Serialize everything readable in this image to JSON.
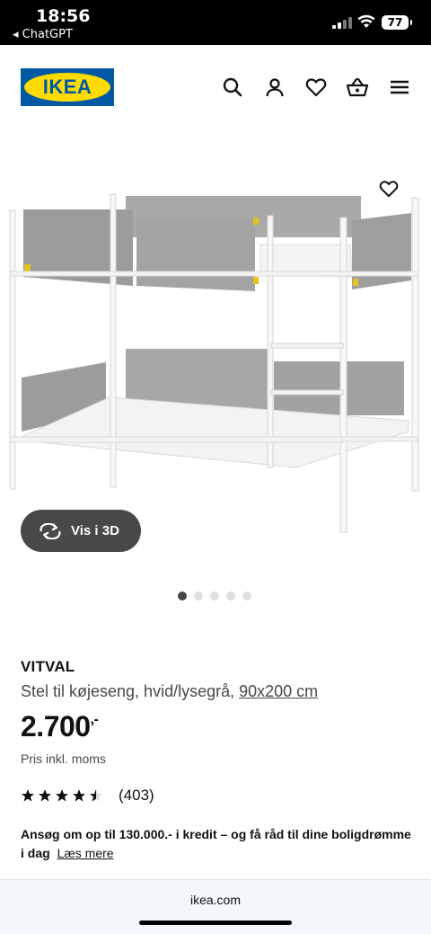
{
  "status_bar": {
    "time": "18:56",
    "back_label": "◂ ChatGPT",
    "battery": "77"
  },
  "header": {
    "logo_text": "IKEA",
    "icons": [
      "search-icon",
      "user-icon",
      "heart-icon",
      "basket-icon",
      "menu-icon"
    ]
  },
  "gallery": {
    "view3d_label": "Vis i 3D",
    "dots_count": 5,
    "active_dot": 0
  },
  "product": {
    "name": "VITVAL",
    "description": "Stel til køjeseng, hvid/lysegrå,",
    "size_link": "90x200 cm",
    "price": "2.700",
    "price_suffix": ",-",
    "price_note": "Pris inkl. moms",
    "rating_stars": 4.5,
    "rating_count": "(403)",
    "credit_text": "Ansøg om op til 130.000.- i kredit – og få råd til dine boligdrømme i dag",
    "credit_link": "Læs mere"
  },
  "browser": {
    "url": "ikea.com"
  },
  "colors": {
    "ikea_blue": "#0058a3",
    "ikea_yellow": "#ffdb00",
    "dark_button": "#484848"
  }
}
